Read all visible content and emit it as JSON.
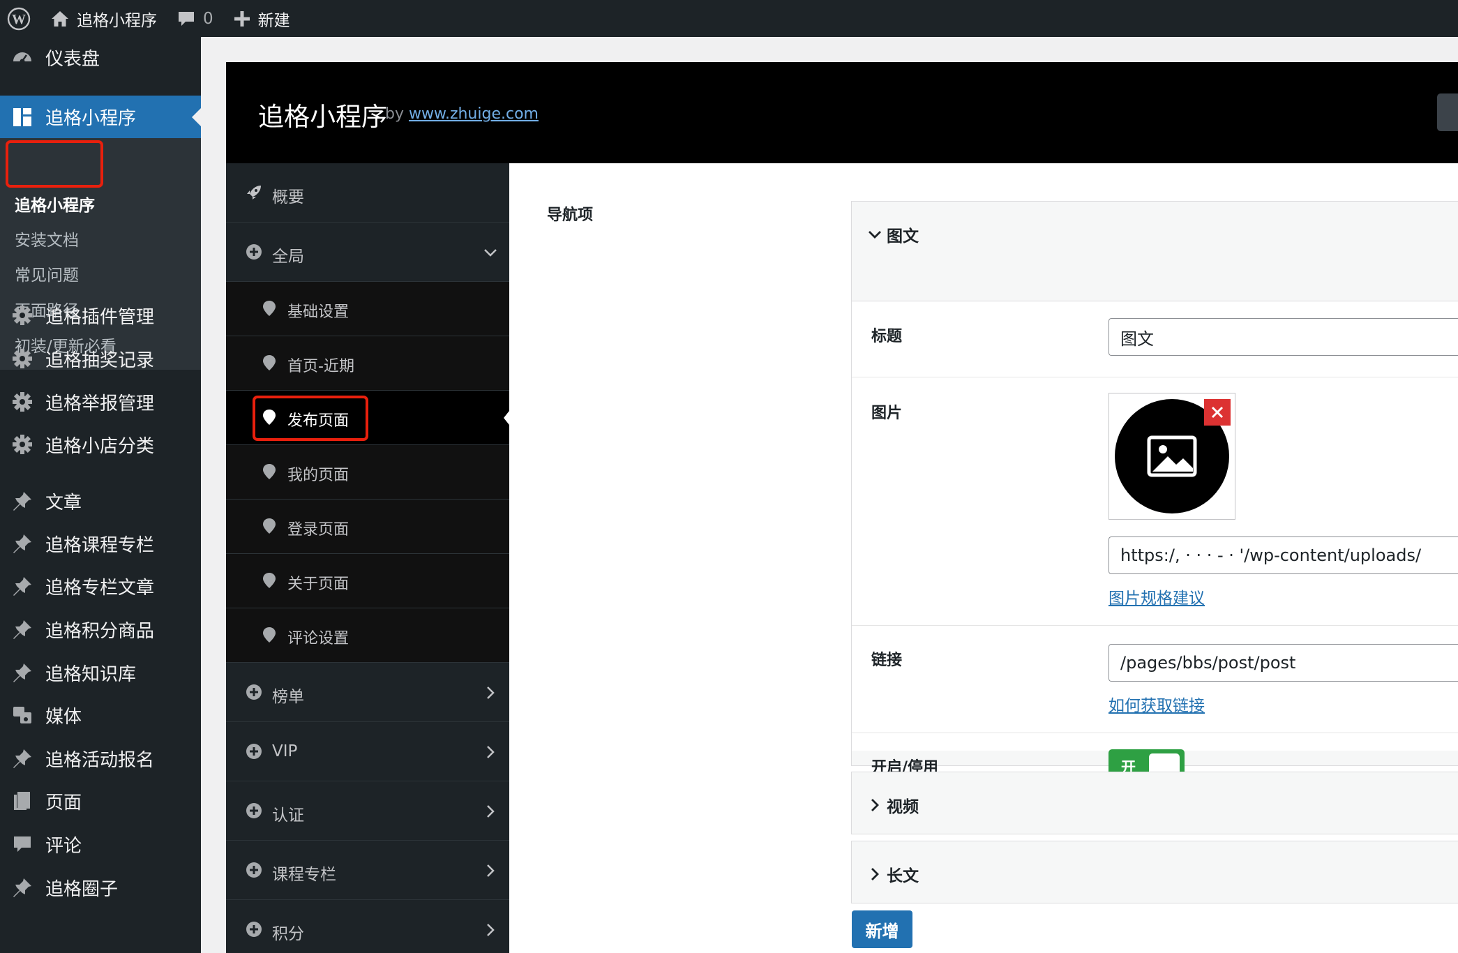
{
  "adminbar": {
    "wp_logo_icon": "wordpress-logo-icon",
    "site_icon": "home-icon",
    "site_name": "追格小程序",
    "comments_icon": "comment-bubble-icon",
    "comments_count": "0",
    "new_icon": "plus-icon",
    "new_label": "新建"
  },
  "adminmenu": {
    "dashboard": "仪表盘",
    "plugin_top": "追格小程序",
    "submenu": [
      "追格小程序",
      "安装文档",
      "常见问题",
      "页面路径",
      "初装/更新必看"
    ],
    "items": [
      {
        "label": "追格插件管理",
        "icon": "gear-icon"
      },
      {
        "label": "追格抽奖记录",
        "icon": "gear-icon"
      },
      {
        "label": "追格举报管理",
        "icon": "gear-icon"
      },
      {
        "label": "追格小店分类",
        "icon": "gear-icon"
      },
      {
        "label": "文章",
        "icon": "pushpin-icon"
      },
      {
        "label": "追格课程专栏",
        "icon": "pushpin-icon"
      },
      {
        "label": "追格专栏文章",
        "icon": "pushpin-icon"
      },
      {
        "label": "追格积分商品",
        "icon": "pushpin-icon"
      },
      {
        "label": "追格知识库",
        "icon": "pushpin-icon"
      },
      {
        "label": "媒体",
        "icon": "media-icon"
      },
      {
        "label": "追格活动报名",
        "icon": "pushpin-icon"
      },
      {
        "label": "页面",
        "icon": "page-icon"
      },
      {
        "label": "评论",
        "icon": "comment-icon"
      },
      {
        "label": "追格圈子",
        "icon": "pushpin-icon"
      }
    ]
  },
  "plugin": {
    "title": "追格小程序",
    "by": "by",
    "site_link": "www.zhuige.com"
  },
  "nav": {
    "overview": "概要",
    "global": "全局",
    "global_children": [
      "基础设置",
      "首页-近期",
      "发布页面",
      "我的页面",
      "登录页面",
      "关于页面",
      "评论设置"
    ],
    "sections": [
      "榜单",
      "VIP",
      "认证",
      "课程专栏",
      "积分"
    ]
  },
  "form": {
    "nav_items_label": "导航项",
    "groups": [
      {
        "title": "图文",
        "expanded": true
      },
      {
        "title": "视频",
        "expanded": false
      },
      {
        "title": "长文",
        "expanded": false
      }
    ],
    "title_label": "标题",
    "title_value": "图文",
    "image_label": "图片",
    "image_url": "https:/,  ·  ·  ·  -   ·    '/wp-content/uploads/",
    "image_hint": "图片规格建议",
    "link_label": "链接",
    "link_value": "/pages/bbs/post/post",
    "link_hint": "如何获取链接",
    "switch_label": "开启/停用",
    "switch_text": "开",
    "switch_on": true,
    "add_button": "新增"
  },
  "colors": {
    "admin_bg": "#1d2327",
    "accent": "#2271b1",
    "highlight_border": "#e8200d",
    "toggle_on": "#2ea043",
    "remove_red": "#dc3232"
  }
}
